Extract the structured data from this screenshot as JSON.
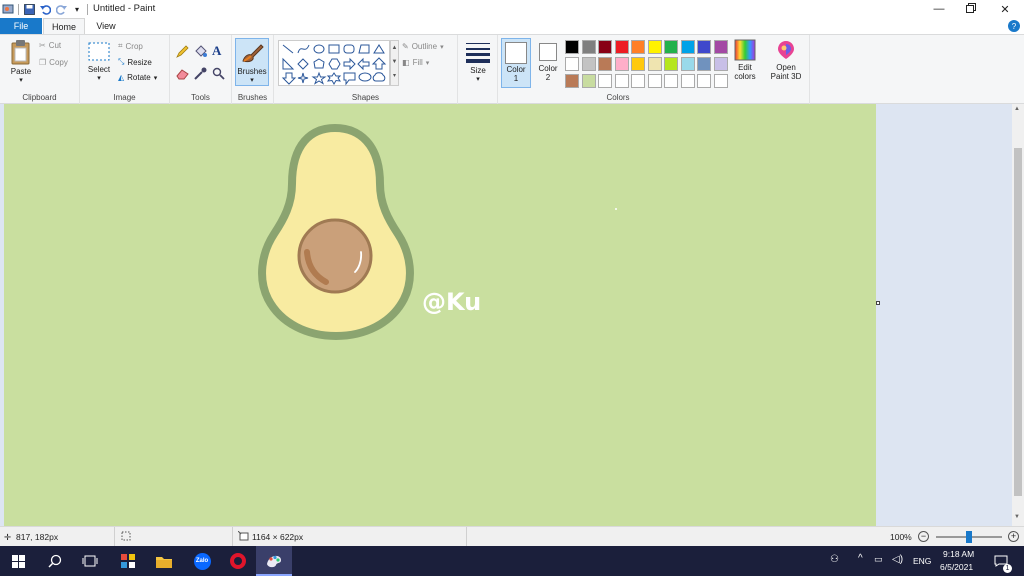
{
  "window": {
    "title": "Untitled - Paint"
  },
  "tabs": {
    "file": "File",
    "home": "Home",
    "view": "View"
  },
  "clipboard": {
    "paste": "Paste",
    "cut": "Cut",
    "copy": "Copy",
    "label": "Clipboard"
  },
  "image": {
    "select": "Select",
    "crop": "Crop",
    "resize": "Resize",
    "rotate": "Rotate",
    "label": "Image"
  },
  "tools": {
    "label": "Tools"
  },
  "brushes": {
    "label": "Brushes"
  },
  "shapes": {
    "outline": "Outline",
    "fill": "Fill",
    "label": "Shapes"
  },
  "size": {
    "label": "Size"
  },
  "colors": {
    "color1": "Color",
    "color1_num": "1",
    "color2": "Color",
    "color2_num": "2",
    "edit": "Edit",
    "edit2": "colors",
    "label": "Colors",
    "palette": [
      "#000000",
      "#7f7f7f",
      "#880015",
      "#ed1c24",
      "#ff7f27",
      "#fff200",
      "#22b14c",
      "#00a2e8",
      "#3f48cc",
      "#a349a4",
      "#ffffff",
      "#c3c3c3",
      "#b97a57",
      "#ffaec9",
      "#ffc90e",
      "#efe4b0",
      "#b5e61d",
      "#99d9ea",
      "#7092be",
      "#c8bfe7",
      "#b97a57",
      "#c8dca0",
      "#ffffff",
      "#ffffff",
      "#ffffff",
      "#ffffff",
      "#ffffff",
      "#ffffff",
      "#ffffff",
      "#ffffff"
    ]
  },
  "paint3d": {
    "line1": "Open",
    "line2": "Paint 3D"
  },
  "canvas": {
    "watermark": "@Ku",
    "bg": "#c9df9f"
  },
  "status": {
    "cursor": "817, 182px",
    "canvas_size": "1164 × 622px",
    "zoom": "100%"
  },
  "tray": {
    "lang": "ENG",
    "time": "9:18 AM",
    "date": "6/5/2021",
    "notif_count": "1"
  }
}
